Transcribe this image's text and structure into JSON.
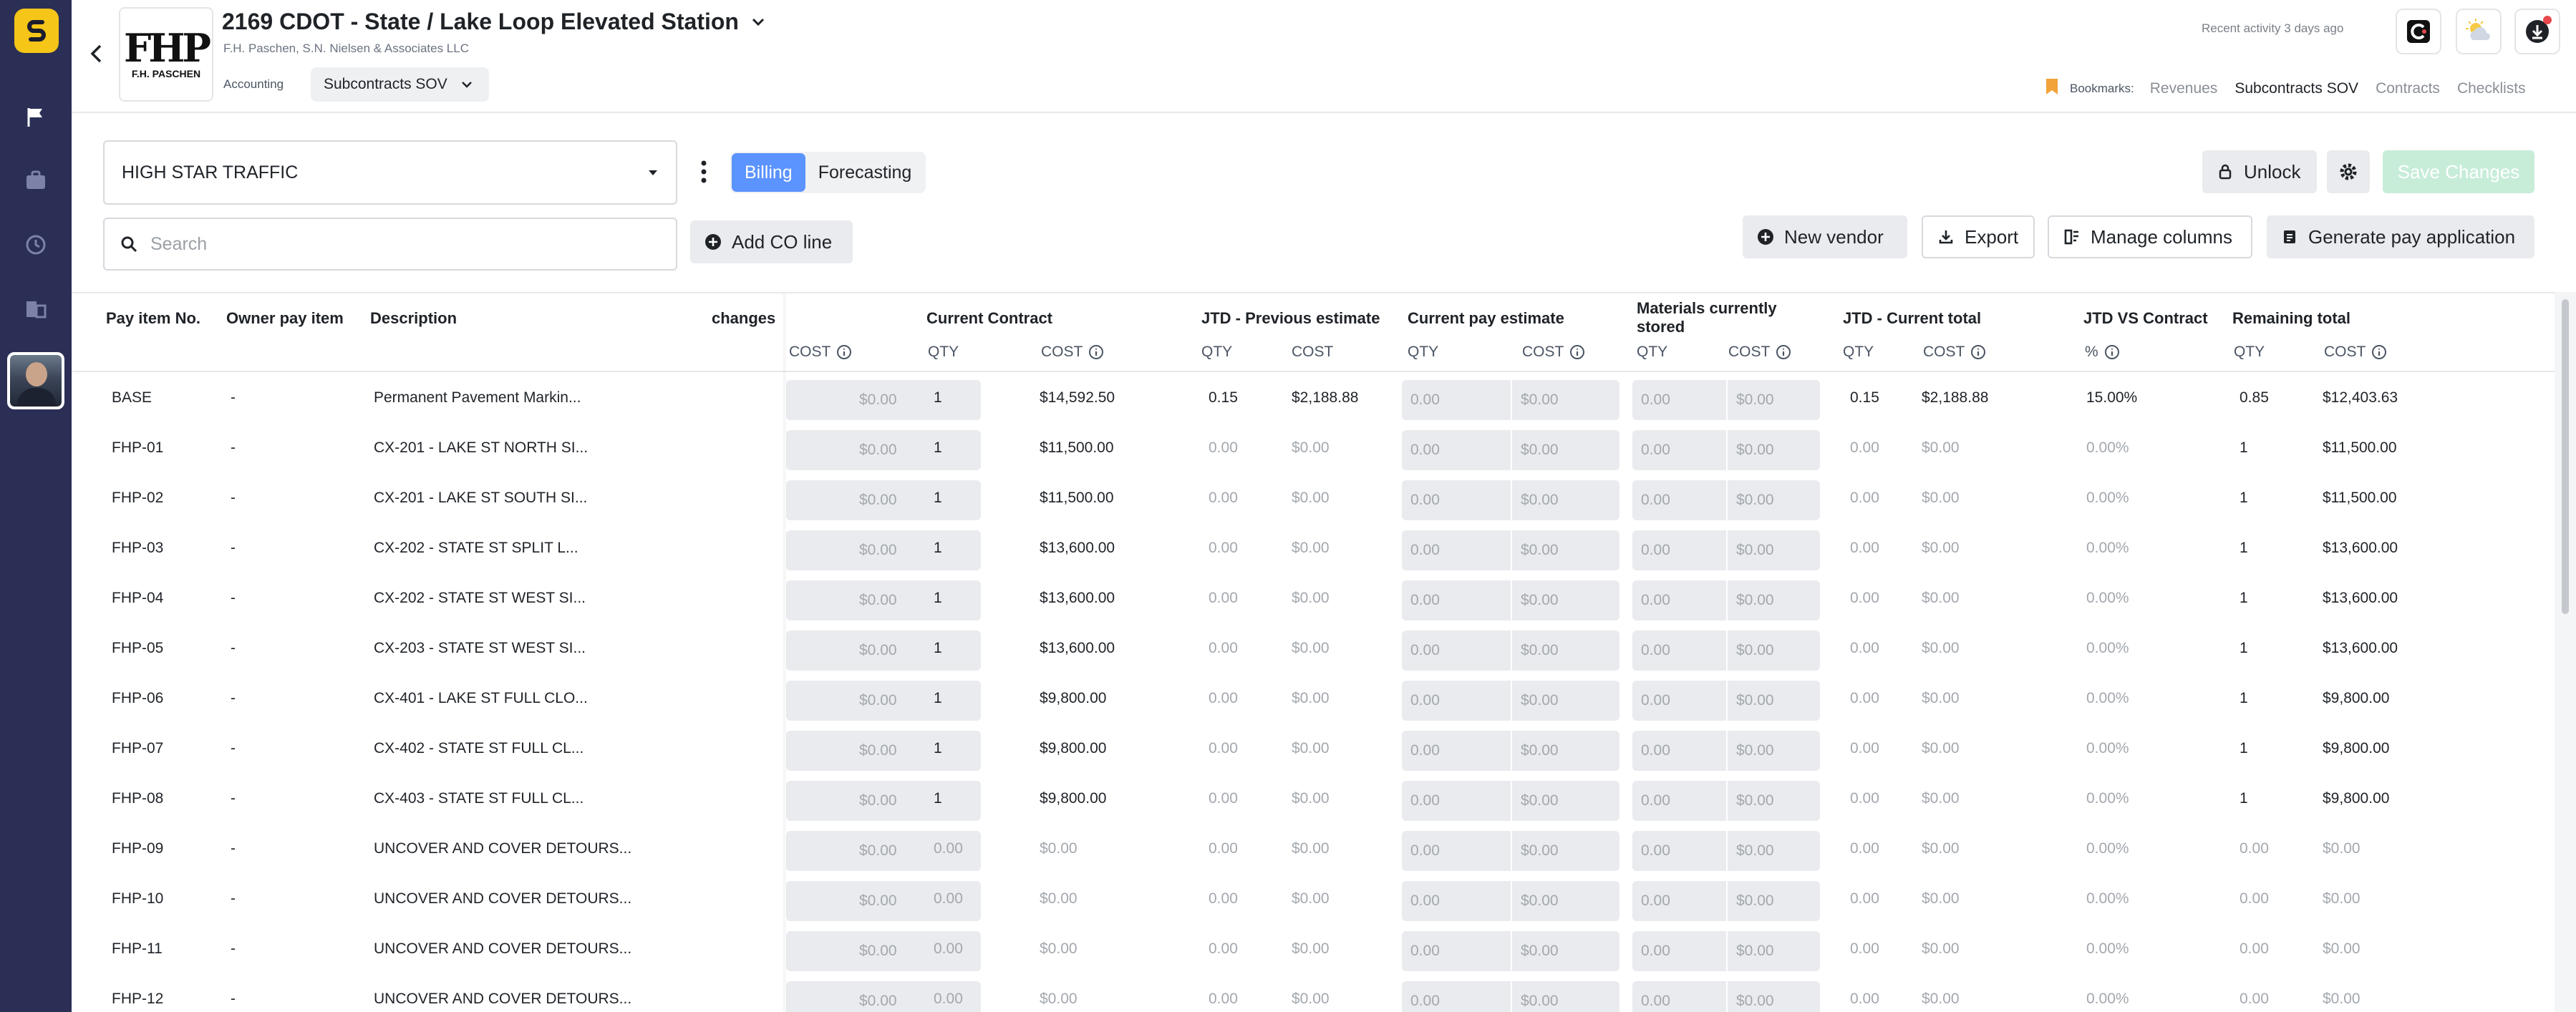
{
  "app": {
    "project_title": "2169 CDOT - State / Lake Loop Elevated Station",
    "company_name": "F.H. Paschen, S.N. Nielsen & Associates LLC",
    "logo_mark": "FHP",
    "logo_sub": "F.H. PASCHEN",
    "module_label": "Accounting",
    "module_value": "Subcontracts SOV",
    "recent_activity": "Recent activity 3 days ago",
    "brand_color": "#f5c518",
    "rail_color": "#2b2f55"
  },
  "bookmarks": {
    "label": "Bookmarks:",
    "items": [
      "Revenues",
      "Subcontracts SOV",
      "Contracts",
      "Checklists"
    ],
    "active": "Subcontracts SOV"
  },
  "toolbar": {
    "vendor": "HIGH STAR TRAFFIC",
    "tabs": [
      "Billing",
      "Forecasting"
    ],
    "active_tab": "Billing",
    "search_placeholder": "Search",
    "add_co_line": "Add CO line",
    "unlock": "Unlock",
    "save_changes": "Save Changes",
    "new_vendor": "New vendor",
    "export": "Export",
    "manage_columns": "Manage columns",
    "generate_pay_app": "Generate pay application",
    "accent_color": "#5b93ff",
    "save_color": "#c7edd9"
  },
  "table": {
    "headers": {
      "pay_item_no": "Pay item No.",
      "owner_pay_item": "Owner pay item",
      "description": "Description",
      "changes": "changes",
      "current_contract": "Current Contract",
      "jtd_previous": "JTD - Previous estimate",
      "current_pay": "Current pay estimate",
      "materials_stored": "Materials currently stored",
      "jtd_current": "JTD - Current total",
      "jtd_vs_contract": "JTD VS Contract",
      "remaining": "Remaining total"
    },
    "sub": {
      "qty": "QTY",
      "cost": "COST",
      "pct": "%"
    },
    "rows": [
      {
        "no": "BASE",
        "owner": "-",
        "desc": "Permanent Pavement Markin...",
        "chg": "$0.00",
        "cc_qty": "1",
        "cc_cost": "$14,592.50",
        "prev_qty": "0.15",
        "prev_cost": "$2,188.88",
        "cur_qty": "0.00",
        "cur_cost": "$0.00",
        "mat_qty": "0.00",
        "mat_cost": "$0.00",
        "jtd_qty": "0.15",
        "jtd_cost": "$2,188.88",
        "pct": "15.00%",
        "rem_qty": "0.85",
        "rem_cost": "$12,403.63"
      },
      {
        "no": "FHP-01",
        "owner": "-",
        "desc": "CX-201 - LAKE ST NORTH SI...",
        "chg": "$0.00",
        "cc_qty": "1",
        "cc_cost": "$11,500.00",
        "prev_qty": "0.00",
        "prev_cost": "$0.00",
        "cur_qty": "0.00",
        "cur_cost": "$0.00",
        "mat_qty": "0.00",
        "mat_cost": "$0.00",
        "jtd_qty": "0.00",
        "jtd_cost": "$0.00",
        "pct": "0.00%",
        "rem_qty": "1",
        "rem_cost": "$11,500.00"
      },
      {
        "no": "FHP-02",
        "owner": "-",
        "desc": "CX-201 - LAKE ST SOUTH SI...",
        "chg": "$0.00",
        "cc_qty": "1",
        "cc_cost": "$11,500.00",
        "prev_qty": "0.00",
        "prev_cost": "$0.00",
        "cur_qty": "0.00",
        "cur_cost": "$0.00",
        "mat_qty": "0.00",
        "mat_cost": "$0.00",
        "jtd_qty": "0.00",
        "jtd_cost": "$0.00",
        "pct": "0.00%",
        "rem_qty": "1",
        "rem_cost": "$11,500.00"
      },
      {
        "no": "FHP-03",
        "owner": "-",
        "desc": "CX-202 - STATE ST SPLIT L...",
        "chg": "$0.00",
        "cc_qty": "1",
        "cc_cost": "$13,600.00",
        "prev_qty": "0.00",
        "prev_cost": "$0.00",
        "cur_qty": "0.00",
        "cur_cost": "$0.00",
        "mat_qty": "0.00",
        "mat_cost": "$0.00",
        "jtd_qty": "0.00",
        "jtd_cost": "$0.00",
        "pct": "0.00%",
        "rem_qty": "1",
        "rem_cost": "$13,600.00"
      },
      {
        "no": "FHP-04",
        "owner": "-",
        "desc": "CX-202 - STATE ST WEST SI...",
        "chg": "$0.00",
        "cc_qty": "1",
        "cc_cost": "$13,600.00",
        "prev_qty": "0.00",
        "prev_cost": "$0.00",
        "cur_qty": "0.00",
        "cur_cost": "$0.00",
        "mat_qty": "0.00",
        "mat_cost": "$0.00",
        "jtd_qty": "0.00",
        "jtd_cost": "$0.00",
        "pct": "0.00%",
        "rem_qty": "1",
        "rem_cost": "$13,600.00"
      },
      {
        "no": "FHP-05",
        "owner": "-",
        "desc": "CX-203 - STATE ST WEST SI...",
        "chg": "$0.00",
        "cc_qty": "1",
        "cc_cost": "$13,600.00",
        "prev_qty": "0.00",
        "prev_cost": "$0.00",
        "cur_qty": "0.00",
        "cur_cost": "$0.00",
        "mat_qty": "0.00",
        "mat_cost": "$0.00",
        "jtd_qty": "0.00",
        "jtd_cost": "$0.00",
        "pct": "0.00%",
        "rem_qty": "1",
        "rem_cost": "$13,600.00"
      },
      {
        "no": "FHP-06",
        "owner": "-",
        "desc": "CX-401 - LAKE ST FULL CLO...",
        "chg": "$0.00",
        "cc_qty": "1",
        "cc_cost": "$9,800.00",
        "prev_qty": "0.00",
        "prev_cost": "$0.00",
        "cur_qty": "0.00",
        "cur_cost": "$0.00",
        "mat_qty": "0.00",
        "mat_cost": "$0.00",
        "jtd_qty": "0.00",
        "jtd_cost": "$0.00",
        "pct": "0.00%",
        "rem_qty": "1",
        "rem_cost": "$9,800.00"
      },
      {
        "no": "FHP-07",
        "owner": "-",
        "desc": "CX-402 - STATE ST FULL CL...",
        "chg": "$0.00",
        "cc_qty": "1",
        "cc_cost": "$9,800.00",
        "prev_qty": "0.00",
        "prev_cost": "$0.00",
        "cur_qty": "0.00",
        "cur_cost": "$0.00",
        "mat_qty": "0.00",
        "mat_cost": "$0.00",
        "jtd_qty": "0.00",
        "jtd_cost": "$0.00",
        "pct": "0.00%",
        "rem_qty": "1",
        "rem_cost": "$9,800.00"
      },
      {
        "no": "FHP-08",
        "owner": "-",
        "desc": "CX-403 - STATE ST FULL CL...",
        "chg": "$0.00",
        "cc_qty": "1",
        "cc_cost": "$9,800.00",
        "prev_qty": "0.00",
        "prev_cost": "$0.00",
        "cur_qty": "0.00",
        "cur_cost": "$0.00",
        "mat_qty": "0.00",
        "mat_cost": "$0.00",
        "jtd_qty": "0.00",
        "jtd_cost": "$0.00",
        "pct": "0.00%",
        "rem_qty": "1",
        "rem_cost": "$9,800.00"
      },
      {
        "no": "FHP-09",
        "owner": "-",
        "desc": "UNCOVER AND COVER DETOURS...",
        "chg": "$0.00",
        "cc_qty": "0.00",
        "cc_cost": "$0.00",
        "prev_qty": "0.00",
        "prev_cost": "$0.00",
        "cur_qty": "0.00",
        "cur_cost": "$0.00",
        "mat_qty": "0.00",
        "mat_cost": "$0.00",
        "jtd_qty": "0.00",
        "jtd_cost": "$0.00",
        "pct": "0.00%",
        "rem_qty": "0.00",
        "rem_cost": "$0.00"
      },
      {
        "no": "FHP-10",
        "owner": "-",
        "desc": "UNCOVER AND COVER DETOURS...",
        "chg": "$0.00",
        "cc_qty": "0.00",
        "cc_cost": "$0.00",
        "prev_qty": "0.00",
        "prev_cost": "$0.00",
        "cur_qty": "0.00",
        "cur_cost": "$0.00",
        "mat_qty": "0.00",
        "mat_cost": "$0.00",
        "jtd_qty": "0.00",
        "jtd_cost": "$0.00",
        "pct": "0.00%",
        "rem_qty": "0.00",
        "rem_cost": "$0.00"
      },
      {
        "no": "FHP-11",
        "owner": "-",
        "desc": "UNCOVER AND COVER DETOURS...",
        "chg": "$0.00",
        "cc_qty": "0.00",
        "cc_cost": "$0.00",
        "prev_qty": "0.00",
        "prev_cost": "$0.00",
        "cur_qty": "0.00",
        "cur_cost": "$0.00",
        "mat_qty": "0.00",
        "mat_cost": "$0.00",
        "jtd_qty": "0.00",
        "jtd_cost": "$0.00",
        "pct": "0.00%",
        "rem_qty": "0.00",
        "rem_cost": "$0.00"
      },
      {
        "no": "FHP-12",
        "owner": "-",
        "desc": "UNCOVER AND COVER DETOURS...",
        "chg": "$0.00",
        "cc_qty": "0.00",
        "cc_cost": "$0.00",
        "prev_qty": "0.00",
        "prev_cost": "$0.00",
        "cur_qty": "0.00",
        "cur_cost": "$0.00",
        "mat_qty": "0.00",
        "mat_cost": "$0.00",
        "jtd_qty": "0.00",
        "jtd_cost": "$0.00",
        "pct": "0.00%",
        "rem_qty": "0.00",
        "rem_cost": "$0.00"
      }
    ]
  }
}
